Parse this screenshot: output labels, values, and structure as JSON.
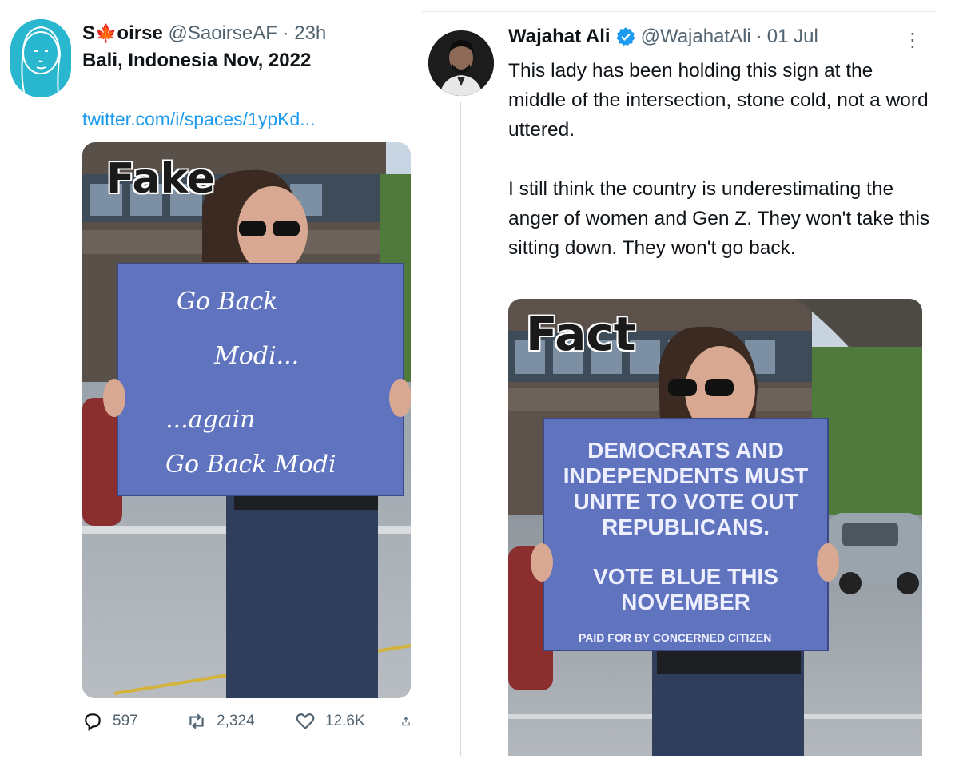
{
  "left_tweet": {
    "display_name_start": "S",
    "display_name_emoji": "🍁",
    "display_name_end": "oirse",
    "handle": "@SaoirseAF",
    "separator": "·",
    "time": "23h",
    "text": "Bali, Indonesia Nov, 2022",
    "link": "twitter.com/i/spaces/1ypKd...",
    "overlay_label": "Fake",
    "sign_lines": [
      "Go Back",
      "Modi...",
      "...again",
      "Go Back Modi"
    ],
    "stats": {
      "replies": "597",
      "retweets": "2,324",
      "likes": "12.6K"
    }
  },
  "right_tweet": {
    "display_name": "Wajahat Ali",
    "handle": "@WajahatAli",
    "separator": "·",
    "time": "01 Jul",
    "more_label": "⋮",
    "paragraph_1": "This lady has been holding this sign at the middle of the intersection, stone cold, not a word uttered.",
    "paragraph_2": "I still think the country is underestimating the anger of women and Gen Z. They won't take this sitting down. They won't go back.",
    "overlay_label": "Fact",
    "sign_lines": [
      "DEMOCRATS AND",
      "INDEPENDENTS MUST",
      "UNITE TO VOTE OUT",
      "REPUBLICANS.",
      "VOTE BLUE THIS",
      "NOVEMBER"
    ],
    "sign_footer": "PAID FOR BY CONCERNED CITIZEN"
  },
  "icons": {
    "reply": "reply-icon",
    "retweet": "retweet-icon",
    "like": "heart-icon",
    "verified": "verified-badge-icon",
    "share": "share-icon"
  },
  "colors": {
    "link": "#1d9bf0",
    "verified": "#1d9bf0",
    "sign": "#5f73bf",
    "secondary_text": "#536471"
  }
}
